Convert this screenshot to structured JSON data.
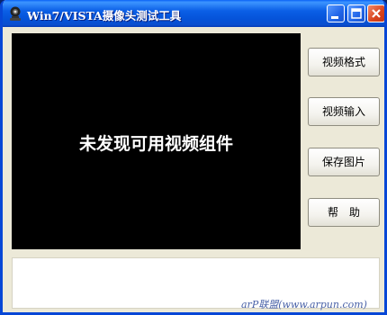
{
  "window": {
    "title": "Win7/VISTA摄像头测试工具"
  },
  "titlebar": {
    "icons": {
      "app": "webcam-icon",
      "minimize": "minimize-icon",
      "maximize": "maximize-icon",
      "close": "close-icon"
    }
  },
  "video": {
    "message": "未发现可用视频组件"
  },
  "buttons": {
    "video_format": "视频格式",
    "video_input": "视频输入",
    "save_picture": "保存图片",
    "help": "帮　助"
  },
  "status": {
    "text": ""
  },
  "watermark": "arP联盟(www.arpun.com)",
  "colors": {
    "titlebar": "#0553d9",
    "window_bg": "#ece9d8",
    "video_bg": "#000000",
    "close_button": "#d8431c"
  }
}
